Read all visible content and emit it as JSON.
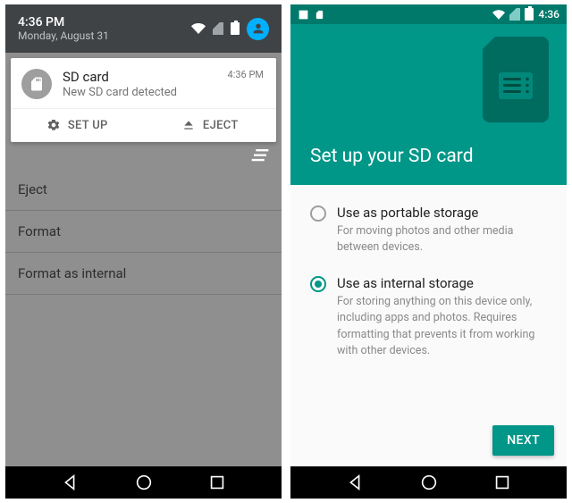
{
  "left": {
    "quick_header": {
      "time": "4:36 PM",
      "date": "Monday, August 31"
    },
    "notification": {
      "title": "SD card",
      "subtitle": "New SD card detected",
      "time": "4:36 PM",
      "action_setup": "SET UP",
      "action_eject": "EJECT"
    },
    "menu": {
      "eject": "Eject",
      "format": "Format",
      "format_internal": "Format as internal"
    }
  },
  "right": {
    "status_time": "4:36",
    "hero_title": "Set up your SD card",
    "option_portable": {
      "title": "Use as portable storage",
      "desc": "For moving photos and other media between devices."
    },
    "option_internal": {
      "title": "Use as internal storage",
      "desc": "For storing anything on this device only, including apps and photos. Requires formatting that prevents it from working with other devices."
    },
    "next_label": "NEXT"
  }
}
